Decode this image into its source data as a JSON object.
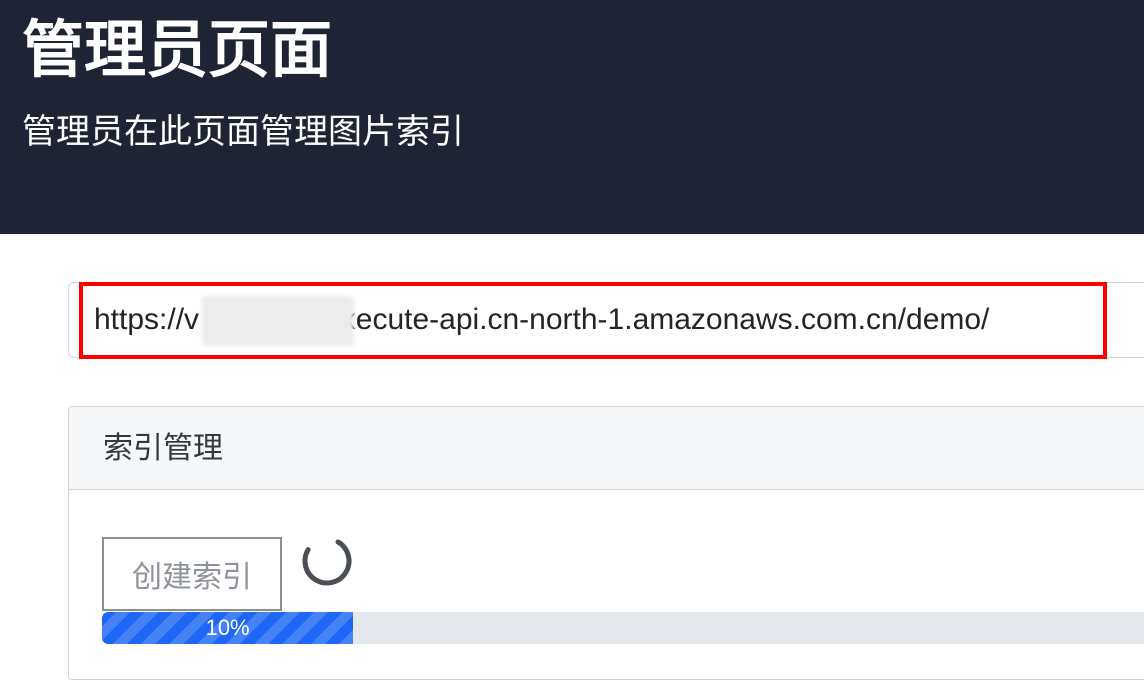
{
  "header": {
    "title": "管理员页面",
    "subtitle": "管理员在此页面管理图片索引"
  },
  "api_url": {
    "value": "https://v              .execute-api.cn-north-1.amazonaws.com.cn/demo/"
  },
  "index_card": {
    "title": "索引管理",
    "create_button_label": "创建索引",
    "progress": {
      "fraction": 0.1,
      "label": "10%"
    }
  },
  "colors": {
    "header_bg": "#1e2433",
    "highlight_border": "#ff0000",
    "progress_fill": "#1e66f5",
    "progress_track": "#e4e7eb"
  },
  "icons": {
    "loading": "loading-spinner-icon"
  }
}
